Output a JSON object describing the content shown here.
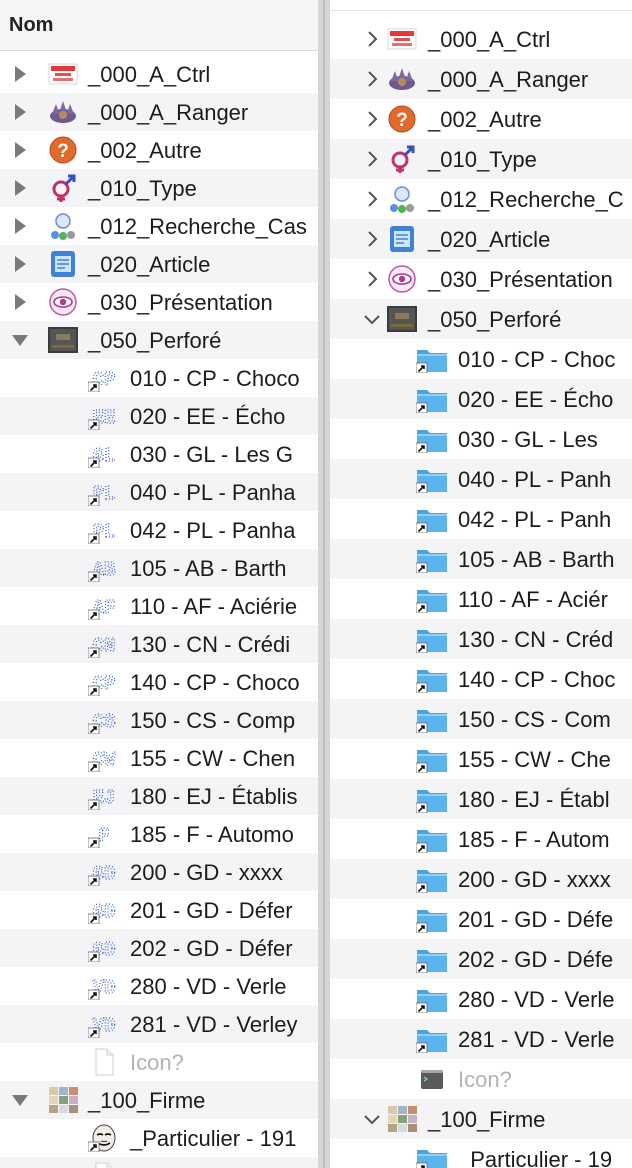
{
  "left": {
    "header": "Nom",
    "rows": [
      {
        "label": "_000_A_Ctrl",
        "level": 0,
        "disclosure": "collapsed",
        "icon": "quality-control-icon"
      },
      {
        "label": "_000_A_Ranger",
        "level": 0,
        "disclosure": "collapsed",
        "icon": "purple-flower-icon"
      },
      {
        "label": "_002_Autre",
        "level": 0,
        "disclosure": "collapsed",
        "icon": "question-mark-icon"
      },
      {
        "label": "_010_Type",
        "level": 0,
        "disclosure": "collapsed",
        "icon": "gender-symbol-icon"
      },
      {
        "label": "_012_Recherche_Cas",
        "level": 0,
        "disclosure": "collapsed",
        "icon": "search-balls-icon"
      },
      {
        "label": "_020_Article",
        "level": 0,
        "disclosure": "collapsed",
        "icon": "article-icon"
      },
      {
        "label": "_030_Présentation",
        "level": 0,
        "disclosure": "collapsed",
        "icon": "eye-icon"
      },
      {
        "label": "_050_Perforé",
        "level": 0,
        "disclosure": "expanded",
        "icon": "perforator-icon"
      },
      {
        "label": "010 - CP - Choco",
        "level": 1,
        "icon": "perfin-alias-icon",
        "code": "CP"
      },
      {
        "label": "020 - EE - Écho",
        "level": 1,
        "icon": "perfin-alias-icon",
        "code": "EE"
      },
      {
        "label": "030 - GL - Les G",
        "level": 1,
        "icon": "perfin-alias-icon",
        "code": "GL"
      },
      {
        "label": "040 - PL - Panha",
        "level": 1,
        "icon": "perfin-alias-icon",
        "code": "PL"
      },
      {
        "label": "042 - PL - Panha",
        "level": 1,
        "icon": "perfin-alias-icon",
        "code": "PL"
      },
      {
        "label": "105 - AB - Barth",
        "level": 1,
        "icon": "perfin-alias-icon",
        "code": "AB"
      },
      {
        "label": "110 - AF - Aciérie",
        "level": 1,
        "icon": "perfin-alias-icon",
        "code": "AF"
      },
      {
        "label": "130 - CN - Crédi",
        "level": 1,
        "icon": "perfin-alias-icon",
        "code": "CN"
      },
      {
        "label": "140 - CP - Choco",
        "level": 1,
        "icon": "perfin-alias-icon",
        "code": "CP"
      },
      {
        "label": "150 - CS - Comp",
        "level": 1,
        "icon": "perfin-alias-icon",
        "code": "CS"
      },
      {
        "label": "155 - CW - Chen",
        "level": 1,
        "icon": "perfin-alias-icon",
        "code": "CW"
      },
      {
        "label": "180 - EJ - Établis",
        "level": 1,
        "icon": "perfin-alias-icon",
        "code": "EJ"
      },
      {
        "label": "185 - F - Automo",
        "level": 1,
        "icon": "perfin-alias-icon",
        "code": "F"
      },
      {
        "label": "200 - GD - xxxx",
        "level": 1,
        "icon": "perfin-alias-icon",
        "code": "GD"
      },
      {
        "label": "201 - GD - Défer",
        "level": 1,
        "icon": "perfin-alias-icon",
        "code": "GD"
      },
      {
        "label": "202 - GD - Défer",
        "level": 1,
        "icon": "perfin-alias-icon",
        "code": "GD"
      },
      {
        "label": "280 - VD - Verle",
        "level": 1,
        "icon": "perfin-alias-icon",
        "code": "VD"
      },
      {
        "label": "281 - VD - Verley",
        "level": 1,
        "icon": "perfin-alias-icon",
        "code": "VD"
      },
      {
        "label": "Icon?",
        "level": 1,
        "icon": "blank-file-icon",
        "dim": true
      },
      {
        "label": "_100_Firme",
        "level": 0,
        "disclosure": "expanded",
        "icon": "firm-collage-icon"
      },
      {
        "label": "_Particulier - 191",
        "level": 1,
        "icon": "anonymous-mask-icon"
      },
      {
        "label": "",
        "level": 1,
        "icon": "blank-file-icon"
      }
    ]
  },
  "right": {
    "rows": [
      {
        "label": "_000_A_Ctrl",
        "level": 0,
        "disclosure": "collapsed",
        "icon": "quality-control-icon"
      },
      {
        "label": "_000_A_Ranger",
        "level": 0,
        "disclosure": "collapsed",
        "icon": "purple-flower-icon"
      },
      {
        "label": "_002_Autre",
        "level": 0,
        "disclosure": "collapsed",
        "icon": "question-mark-icon"
      },
      {
        "label": "_010_Type",
        "level": 0,
        "disclosure": "collapsed",
        "icon": "gender-symbol-icon"
      },
      {
        "label": "_012_Recherche_C",
        "level": 0,
        "disclosure": "collapsed",
        "icon": "search-balls-icon"
      },
      {
        "label": "_020_Article",
        "level": 0,
        "disclosure": "collapsed",
        "icon": "article-icon"
      },
      {
        "label": "_030_Présentation",
        "level": 0,
        "disclosure": "collapsed",
        "icon": "eye-icon"
      },
      {
        "label": "_050_Perforé",
        "level": 0,
        "disclosure": "expanded",
        "icon": "perforator-icon"
      },
      {
        "label": "010 - CP - Choc",
        "level": 1,
        "icon": "folder-alias-icon"
      },
      {
        "label": "020 - EE - Écho",
        "level": 1,
        "icon": "folder-alias-icon"
      },
      {
        "label": "030 - GL - Les",
        "level": 1,
        "icon": "folder-alias-icon"
      },
      {
        "label": "040 - PL - Panh",
        "level": 1,
        "icon": "folder-alias-icon"
      },
      {
        "label": "042 - PL - Panh",
        "level": 1,
        "icon": "folder-alias-icon"
      },
      {
        "label": "105 - AB - Barth",
        "level": 1,
        "icon": "folder-alias-icon"
      },
      {
        "label": "110 - AF - Aciér",
        "level": 1,
        "icon": "folder-alias-icon"
      },
      {
        "label": "130 - CN - Créd",
        "level": 1,
        "icon": "folder-alias-icon"
      },
      {
        "label": "140 - CP - Choc",
        "level": 1,
        "icon": "folder-alias-icon"
      },
      {
        "label": "150 - CS - Com",
        "level": 1,
        "icon": "folder-alias-icon"
      },
      {
        "label": "155 - CW - Che",
        "level": 1,
        "icon": "folder-alias-icon"
      },
      {
        "label": "180 - EJ - Établ",
        "level": 1,
        "icon": "folder-alias-icon"
      },
      {
        "label": "185 - F - Autom",
        "level": 1,
        "icon": "folder-alias-icon"
      },
      {
        "label": "200 - GD - xxxx",
        "level": 1,
        "icon": "folder-alias-icon"
      },
      {
        "label": "201 - GD - Défe",
        "level": 1,
        "icon": "folder-alias-icon"
      },
      {
        "label": "202 - GD - Défe",
        "level": 1,
        "icon": "folder-alias-icon"
      },
      {
        "label": "280 - VD - Verle",
        "level": 1,
        "icon": "folder-alias-icon"
      },
      {
        "label": "281 - VD - Verle",
        "level": 1,
        "icon": "folder-alias-icon"
      },
      {
        "label": "Icon?",
        "level": 1,
        "icon": "terminal-file-icon",
        "dim": true
      },
      {
        "label": "_100_Firme",
        "level": 0,
        "disclosure": "expanded",
        "icon": "firm-collage-icon"
      },
      {
        "label": "_Particulier - 19",
        "level": 1,
        "icon": "folder-alias-icon"
      }
    ]
  },
  "colors": {
    "folder": "#5cb4ee",
    "folder_tab": "#4fa3dc",
    "perfin_dots": "#2f55d4",
    "disclosure": "#7a7a7a",
    "dim_text": "#b3b3b3",
    "alt_row": "#f4f4f6"
  }
}
